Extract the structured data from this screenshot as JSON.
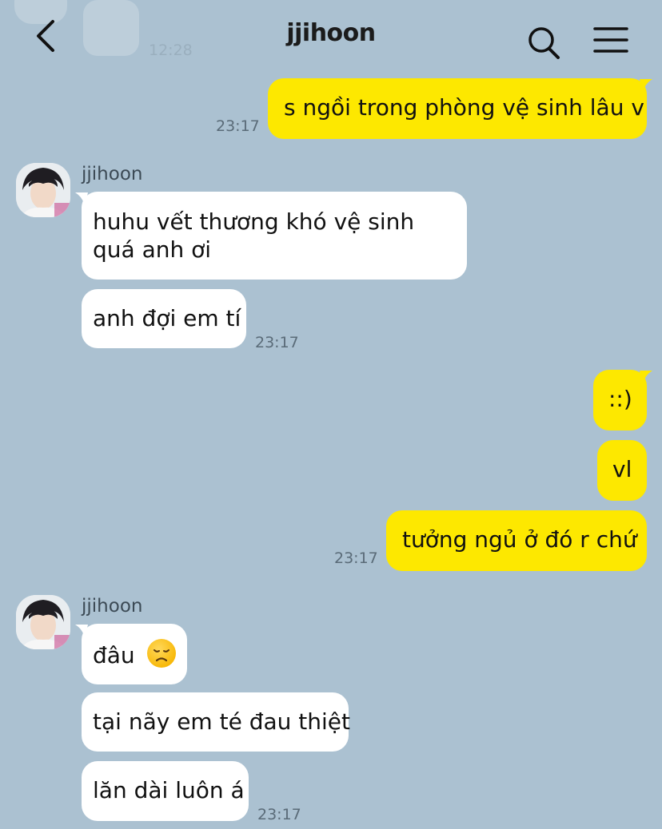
{
  "header": {
    "title": "jjihoon",
    "back_icon": "chevron-left-icon",
    "search_icon": "search-icon",
    "menu_icon": "hamburger-menu-icon"
  },
  "ghost_time": "12:28",
  "colors": {
    "background": "#abc1d1",
    "my_bubble": "#fde800",
    "their_bubble": "#ffffff"
  },
  "messages": [
    {
      "from": "me",
      "text": "s ngồi trong phòng vệ sinh lâu v",
      "time": "23:17"
    },
    {
      "from": "them",
      "sender": "jjihoon",
      "text": "huhu vết thương khó vệ sinh quá anh ơi"
    },
    {
      "from": "them",
      "text": "anh đợi em tí",
      "time": "23:17"
    },
    {
      "from": "me",
      "text": "::)"
    },
    {
      "from": "me",
      "text": "vl"
    },
    {
      "from": "me",
      "text": "tưởng ngủ ở đó r chứ",
      "time": "23:17"
    },
    {
      "from": "them",
      "sender": "jjihoon",
      "text": "đâu",
      "emoji": "disappointed-face"
    },
    {
      "from": "them",
      "text": "tại nãy em té đau thiệt"
    },
    {
      "from": "them",
      "text": "lăn dài luôn á",
      "time": "23:17"
    }
  ]
}
